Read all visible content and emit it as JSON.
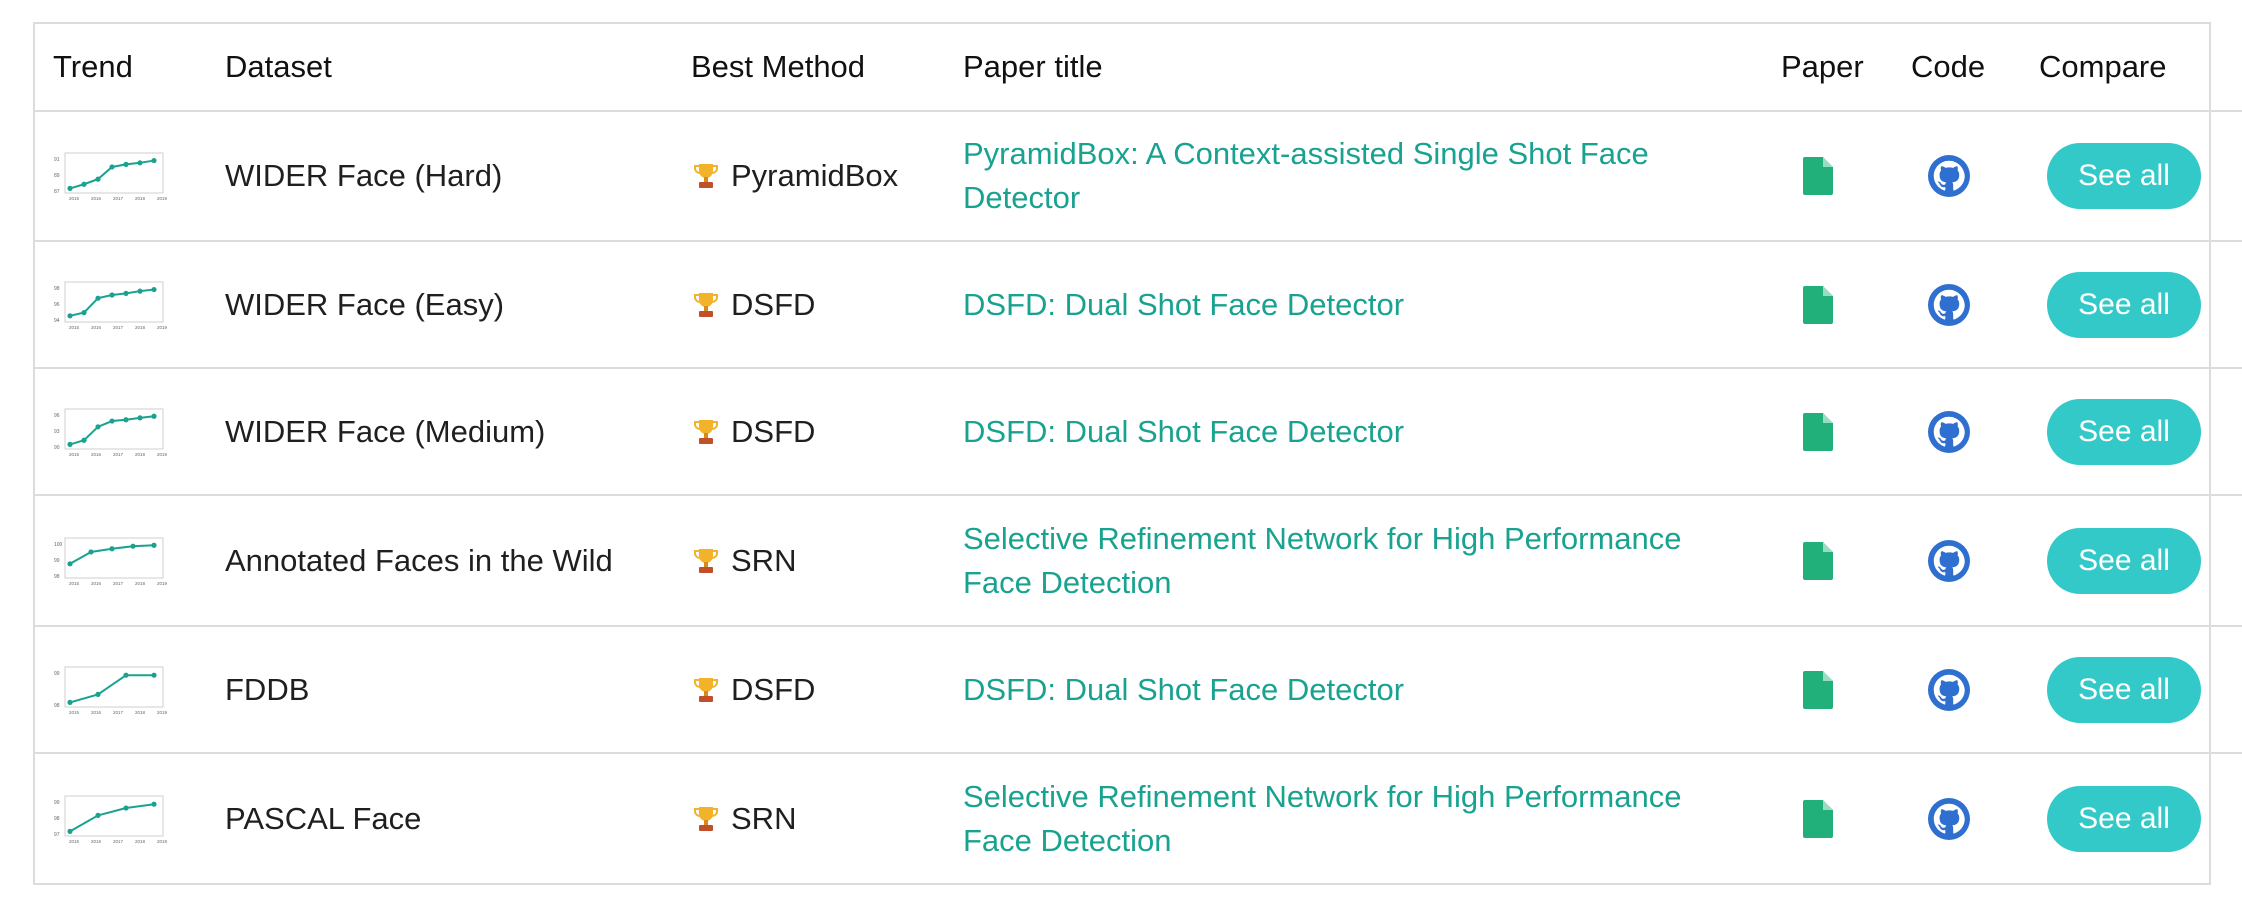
{
  "headers": {
    "trend": "Trend",
    "dataset": "Dataset",
    "best_method": "Best Method",
    "paper_title": "Paper title",
    "paper": "Paper",
    "code": "Code",
    "compare": "Compare"
  },
  "colors": {
    "accent": "#1aa290",
    "button": "#34c9c9",
    "paper_icon": "#22b07a",
    "code_icon": "#2f6fcf",
    "trophy": "#f2b32a"
  },
  "icons": {
    "best": "trophy-icon",
    "paper": "paper-file-icon",
    "code": "github-icon"
  },
  "rows": [
    {
      "dataset": "WIDER Face (Hard)",
      "best_method": "PyramidBox",
      "paper_title": "PyramidBox: A Context-assisted Single Shot Face Detector",
      "compare": "See all",
      "trend": {
        "y_ticks": [
          "91",
          "89",
          "87"
        ],
        "x_ticks": [
          "2015",
          "2016",
          "2017",
          "2018",
          "2019"
        ],
        "points": [
          0.05,
          0.18,
          0.34,
          0.72,
          0.8,
          0.85,
          0.92
        ]
      }
    },
    {
      "dataset": "WIDER Face (Easy)",
      "best_method": "DSFD",
      "paper_title": "DSFD: Dual Shot Face Detector",
      "compare": "See all",
      "trend": {
        "y_ticks": [
          "98",
          "96",
          "94"
        ],
        "x_ticks": [
          "2015",
          "2016",
          "2017",
          "2018",
          "2019"
        ],
        "points": [
          0.1,
          0.2,
          0.65,
          0.75,
          0.8,
          0.87,
          0.92
        ]
      }
    },
    {
      "dataset": "WIDER Face (Medium)",
      "best_method": "DSFD",
      "paper_title": "DSFD: Dual Shot Face Detector",
      "compare": "See all",
      "trend": {
        "y_ticks": [
          "96",
          "93",
          "90"
        ],
        "x_ticks": [
          "2015",
          "2016",
          "2017",
          "2018",
          "2019"
        ],
        "points": [
          0.05,
          0.18,
          0.6,
          0.78,
          0.82,
          0.88,
          0.93
        ]
      }
    },
    {
      "dataset": "Annotated Faces in the Wild",
      "best_method": "SRN",
      "paper_title": "Selective Refinement Network for High Performance Face Detection",
      "compare": "See all",
      "trend": {
        "y_ticks": [
          "100",
          "99",
          "98"
        ],
        "x_ticks": [
          "2015",
          "2016",
          "2017",
          "2018",
          "2019"
        ],
        "points": [
          0.35,
          0.72,
          0.82,
          0.9,
          0.93
        ]
      }
    },
    {
      "dataset": "FDDB",
      "best_method": "DSFD",
      "paper_title": "DSFD: Dual Shot Face Detector",
      "compare": "See all",
      "trend": {
        "y_ticks": [
          "99",
          "98"
        ],
        "x_ticks": [
          "2015",
          "2016",
          "2017",
          "2018",
          "2019"
        ],
        "points": [
          0.05,
          0.3,
          0.9,
          0.9
        ]
      }
    },
    {
      "dataset": "PASCAL Face",
      "best_method": "SRN",
      "paper_title": "Selective Refinement Network for High Performance Face Detection",
      "compare": "See all",
      "trend": {
        "y_ticks": [
          "99",
          "98",
          "97"
        ],
        "x_ticks": [
          "2015",
          "2016",
          "2017",
          "2018",
          "2019"
        ],
        "points": [
          0.05,
          0.55,
          0.78,
          0.9
        ]
      }
    }
  ]
}
